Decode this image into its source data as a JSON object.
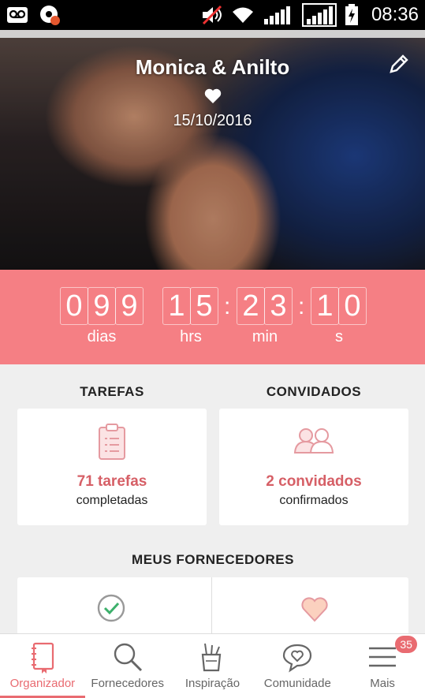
{
  "status_bar": {
    "time": "08:36",
    "icons": [
      "voicemail-icon",
      "notification-app-icon",
      "volume-muted-icon",
      "wifi-icon",
      "signal-1-icon",
      "signal-2-icon",
      "battery-charging-icon"
    ]
  },
  "hero": {
    "couple_name": "Monica & Anilto",
    "date": "15/10/2016",
    "heart_icon": "heart-icon",
    "edit_icon": "pencil-icon"
  },
  "countdown": {
    "days": [
      "0",
      "9",
      "9"
    ],
    "hours": [
      "1",
      "5"
    ],
    "minutes": [
      "2",
      "3"
    ],
    "seconds": [
      "1",
      "0"
    ],
    "labels": {
      "days": "dias",
      "hours": "hrs",
      "minutes": "min",
      "seconds": "s"
    }
  },
  "tasks": {
    "title": "TAREFAS",
    "main": "71 tarefas",
    "sub": "completadas"
  },
  "guests": {
    "title": "CONVIDADOS",
    "main": "2 convidados",
    "sub": "confirmados"
  },
  "vendors": {
    "title": "MEUS FORNECEDORES"
  },
  "bottom_nav": {
    "items": [
      {
        "label": "Organizador",
        "icon": "notebook-icon"
      },
      {
        "label": "Fornecedores",
        "icon": "search-icon"
      },
      {
        "label": "Inspiração",
        "icon": "pencil-cup-icon"
      },
      {
        "label": "Comunidade",
        "icon": "heart-chat-icon"
      },
      {
        "label": "Mais",
        "icon": "hamburger-menu-icon"
      }
    ],
    "badge": "35"
  },
  "colors": {
    "accent": "#f57f84",
    "accent_text": "#d65f66"
  }
}
